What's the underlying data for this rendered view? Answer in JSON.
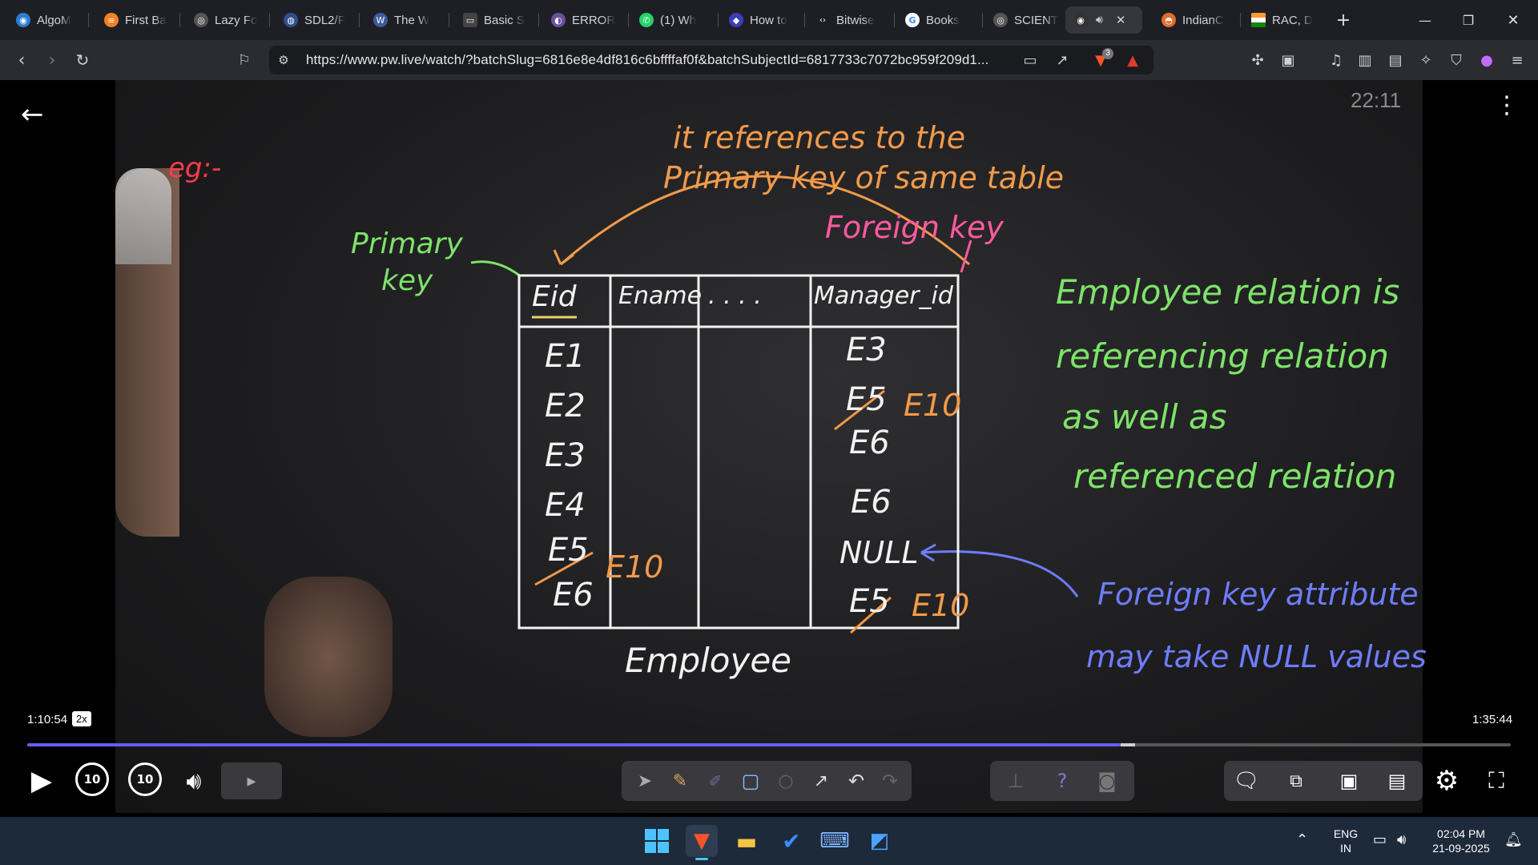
{
  "browser": {
    "tabs": [
      {
        "label": "AlgoM",
        "icon": "algomaster-favicon"
      },
      {
        "label": "First Ba",
        "icon": "stack-favicon"
      },
      {
        "label": "Lazy Fo",
        "icon": "globe-favicon"
      },
      {
        "label": "SDL2/F",
        "icon": "sdl-favicon"
      },
      {
        "label": "The W",
        "icon": "w3-favicon"
      },
      {
        "label": "Basic S",
        "icon": "doc-favicon"
      },
      {
        "label": "ERROR",
        "icon": "error-favicon"
      },
      {
        "label": "(1) Wh",
        "icon": "whatsapp-favicon"
      },
      {
        "label": "How to",
        "icon": "shield-favicon"
      },
      {
        "label": "Bitwise",
        "icon": "code-favicon"
      },
      {
        "label": "Books",
        "icon": "google-favicon"
      },
      {
        "label": "SCIENT",
        "icon": "globe-favicon"
      },
      {
        "label": "",
        "icon": "audio-tab-favicon",
        "active": true
      },
      {
        "label": "IndianC",
        "icon": "indiancar-favicon"
      },
      {
        "label": "RAC, D",
        "icon": "india-flag-favicon"
      }
    ],
    "new_tab_symbol": "+",
    "url": "https://www.pw.live/watch/?batchSlug=6816e8e4df816c6bffffaf0f&batchSubjectId=6817733c7072bc959f209d1...",
    "brave_badge": "3"
  },
  "video": {
    "board_timestamp": "22:11",
    "current_time": "1:10:54",
    "speed": "2x",
    "duration": "1:35:44",
    "progress_fraction": 0.737,
    "buffered_fraction": 0.747,
    "skip_back_label": "10",
    "skip_fwd_label": "10"
  },
  "board": {
    "eg": "eg:-",
    "top_arrow_text_1": "it references to the",
    "top_arrow_text_2": "Primary key of same table",
    "foreign_key_label": "Foreign key",
    "primary_key_label_1": "Primary",
    "primary_key_label_2": "key",
    "table_caption": "Employee",
    "col_eid": "Eid",
    "col_ename": "Ename",
    "col_dots": ". . . .",
    "col_manager": "Manager_id",
    "eid_values": [
      "E1",
      "E2",
      "E3",
      "E4",
      "E5",
      "E6"
    ],
    "eid_correction": "E10",
    "manager_values": [
      "E3",
      "E5",
      "E6",
      "",
      "E6",
      "NULL",
      "E5"
    ],
    "manager_correction": "E10",
    "note_right_1": "Employee relation is",
    "note_right_2": "referencing relation",
    "note_right_3": "as well as",
    "note_right_4": "referenced relation",
    "note_null_1": "Foreign key attribute",
    "note_null_2": "may take NULL values"
  },
  "taskbar": {
    "lang_1": "ENG",
    "lang_2": "IN",
    "time": "02:04 PM",
    "date": "21-09-2025"
  },
  "colors": {
    "orange": "#f29a4a",
    "pink": "#ff5aa0",
    "green": "#7ee36a",
    "blue": "#6e7dff",
    "white_chalk": "#f2f2f2",
    "progress": "#6a5cf0"
  }
}
